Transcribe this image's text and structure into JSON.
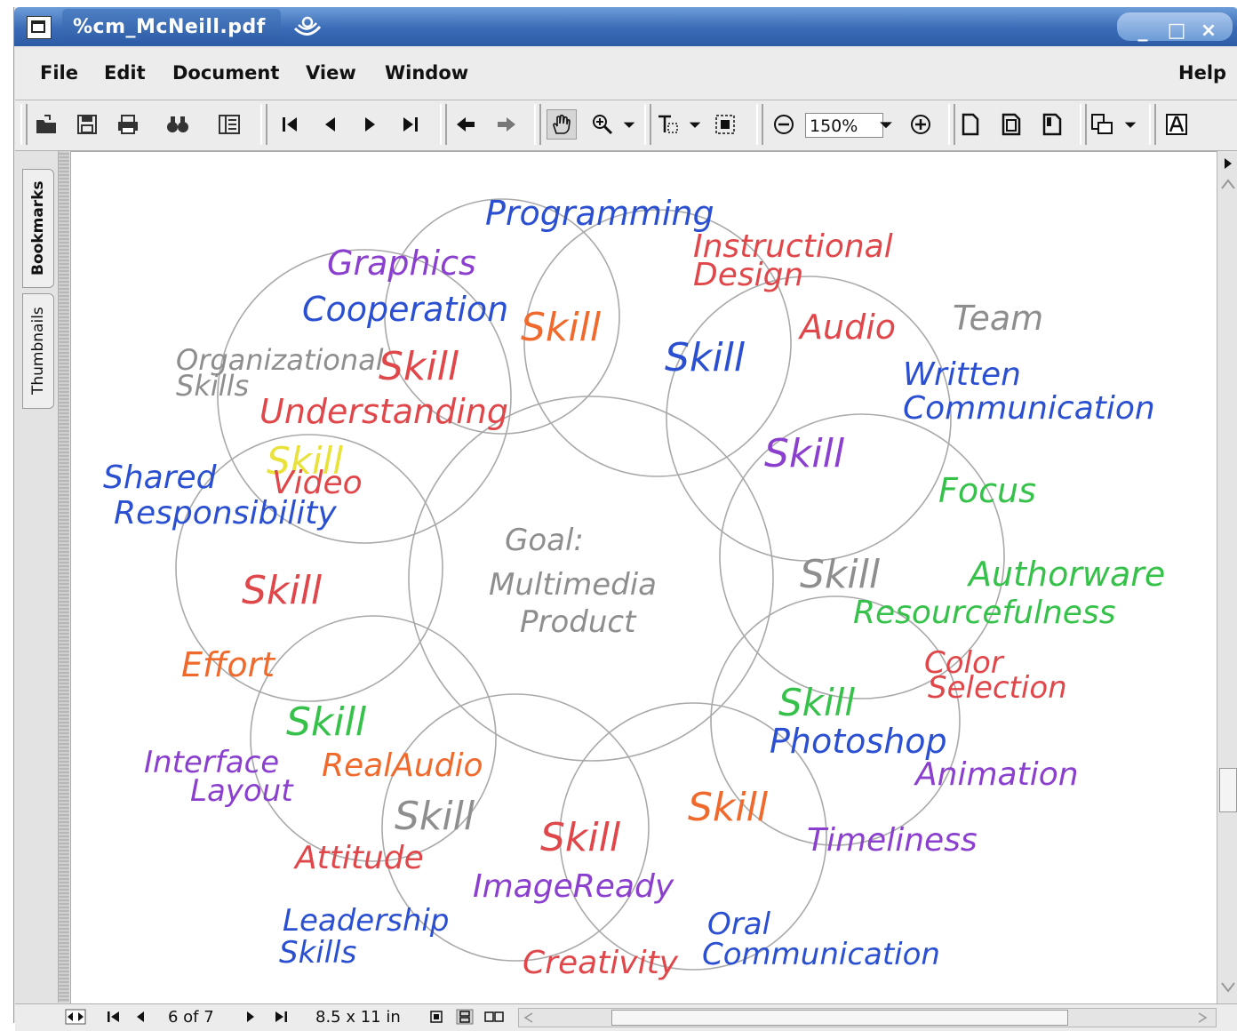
{
  "window": {
    "title": "%cm_McNeill.pdf",
    "controls": {
      "minimize": "_",
      "maximize": "□",
      "close": "×"
    }
  },
  "menu": {
    "file": "File",
    "edit": "Edit",
    "document": "Document",
    "view": "View",
    "window": "Window",
    "help": "Help"
  },
  "toolbar": {
    "zoom_value": "150%"
  },
  "sidebar": {
    "tabs": [
      "Bookmarks",
      "Thumbnails"
    ]
  },
  "document": {
    "center": [
      "Goal:",
      "Multimedia",
      "Product"
    ],
    "words": {
      "programming": "Programming",
      "instructional_1": "Instructional",
      "instructional_2": "Design",
      "graphics": "Graphics",
      "cooperation": "Cooperation",
      "team": "Team",
      "audio": "Audio",
      "org_1": "Organizational",
      "org_2": "Skills",
      "understanding": "Understanding",
      "written_1": "Written",
      "written_2": "Communication",
      "shared_1": "Shared",
      "shared_2": "Responsibility",
      "video": "Video",
      "focus": "Focus",
      "authorware": "Authorware",
      "resourcefulness": "Resourcefulness",
      "effort": "Effort",
      "color_1": "Color",
      "color_2": "Selection",
      "photoshop": "Photoshop",
      "animation": "Animation",
      "interface_1": "Interface",
      "interface_2": "Layout",
      "realaudio": "RealAudio",
      "timeliness": "Timeliness",
      "attitude": "Attitude",
      "imageready": "ImageReady",
      "leadership_1": "Leadership",
      "leadership_2": "Skills",
      "oral_1": "Oral",
      "oral_2": "Communication",
      "creativity": "Creativity",
      "skill": "Skill"
    },
    "colors": {
      "blue": "#2a4fd0",
      "purple": "#8a3fcf",
      "red": "#e0474a",
      "orange": "#ef6a2c",
      "green": "#36c24a",
      "gray": "#8e8e8e",
      "yellow": "#e8e23a"
    }
  },
  "status": {
    "page": "6 of 7",
    "size": "8.5 x 11 in"
  }
}
